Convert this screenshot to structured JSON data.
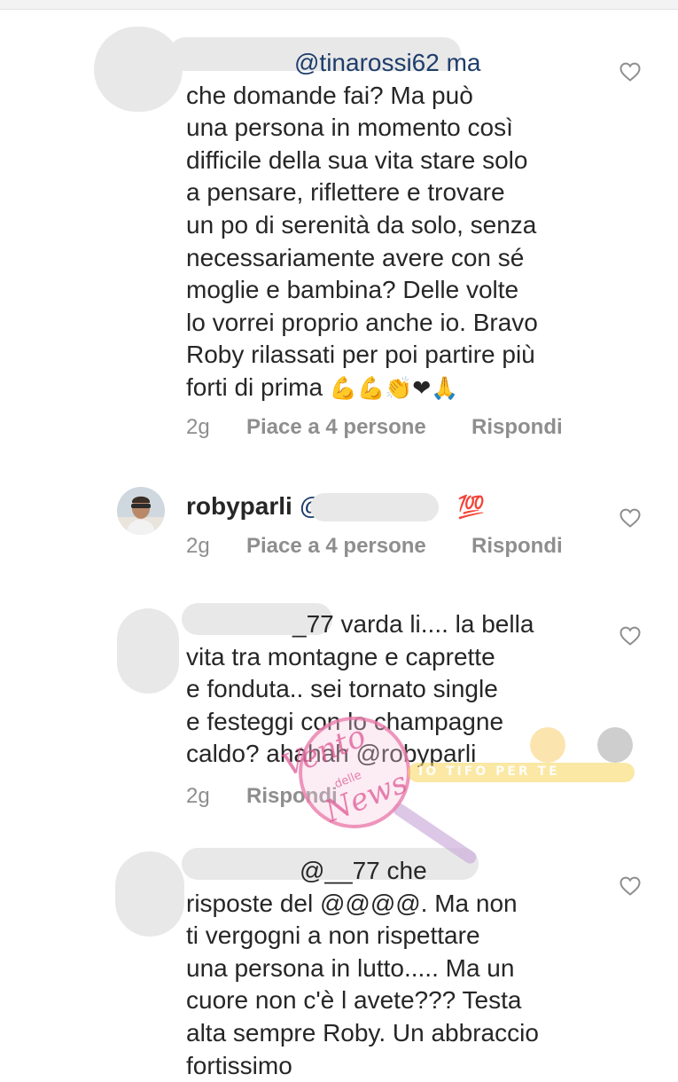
{
  "comments": [
    {
      "lines": [
        "@tinarossi62 ma",
        "che domande fai? Ma può",
        "una persona in momento così",
        "difficile della sua vita stare solo",
        "a pensare, riflettere e trovare",
        "un po di serenità da solo, senza",
        "necessariamente avere con sé",
        "moglie e bambina? Delle volte",
        "lo vorrei proprio anche io. Bravo",
        "Roby rilassati per poi partire più",
        "forti di prima"
      ],
      "emojis": "💪💪👏❤🙏",
      "time": "2g",
      "likes": "Piace a 4 persone",
      "reply": "Rispondi"
    },
    {
      "username": "robyparli",
      "mention": "@",
      "emoji": "💯",
      "time": "2g",
      "likes": "Piace a 4 persone",
      "reply": "Rispondi"
    },
    {
      "lines": [
        "_77 varda li.... la bella",
        "vita tra montagne e caprette",
        "e fonduta.. sei tornato single",
        "e festeggi con lo champagne",
        "caldo?  ahahah  @robyparli"
      ],
      "time": "2g",
      "reply": "Rispondi"
    },
    {
      "lines": [
        "@__77 che",
        "risposte del @@@@. Ma non",
        "ti vergogni a non rispettare",
        "una persona in lutto..... Ma un",
        "cuore non c'è l avete??? Testa",
        "alta sempre Roby. Un abbraccio",
        "fortissimo"
      ]
    }
  ],
  "watermark": {
    "line1": "Vento",
    "line2": "delle",
    "line3": "News",
    "banner": "IO TIFO PER TE"
  },
  "colors": {
    "text": "#262626",
    "meta": "#8e8e8e",
    "mention": "#1e3d6b",
    "heart": "#8e8e8e"
  },
  "icons": {
    "like": "heart-outline-icon"
  }
}
